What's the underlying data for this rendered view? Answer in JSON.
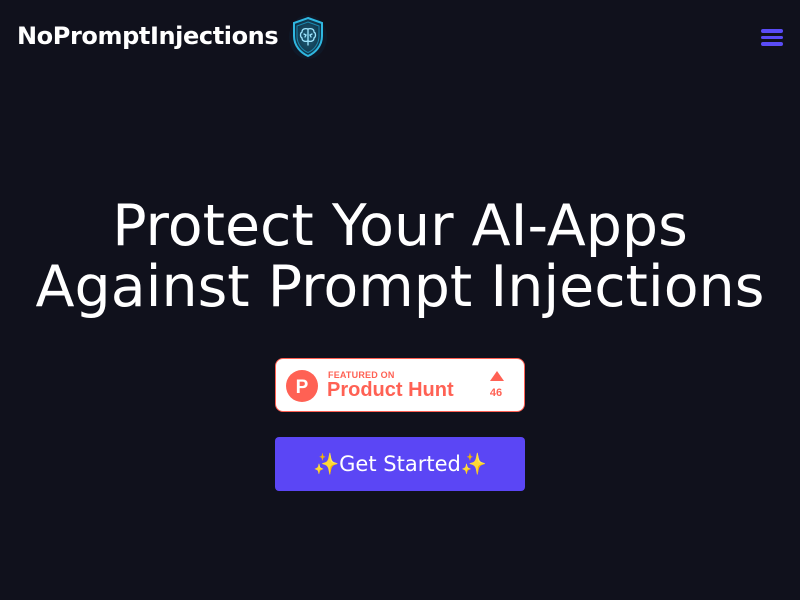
{
  "header": {
    "brand": "NoPromptInjections",
    "logo_icon": "shield-brain-icon",
    "menu_icon": "hamburger-menu-icon"
  },
  "hero": {
    "title_line1": "Protect Your AI-Apps",
    "title_line2": "Against Prompt Injections"
  },
  "product_hunt": {
    "featured_label": "FEATURED ON",
    "name": "Product Hunt",
    "upvotes": "46",
    "logo_letter": "P"
  },
  "cta": {
    "label": "✨Get Started✨"
  },
  "colors": {
    "background": "#10111c",
    "accent": "#5b46f5",
    "product_hunt": "#ff6154",
    "text": "#ffffff"
  }
}
